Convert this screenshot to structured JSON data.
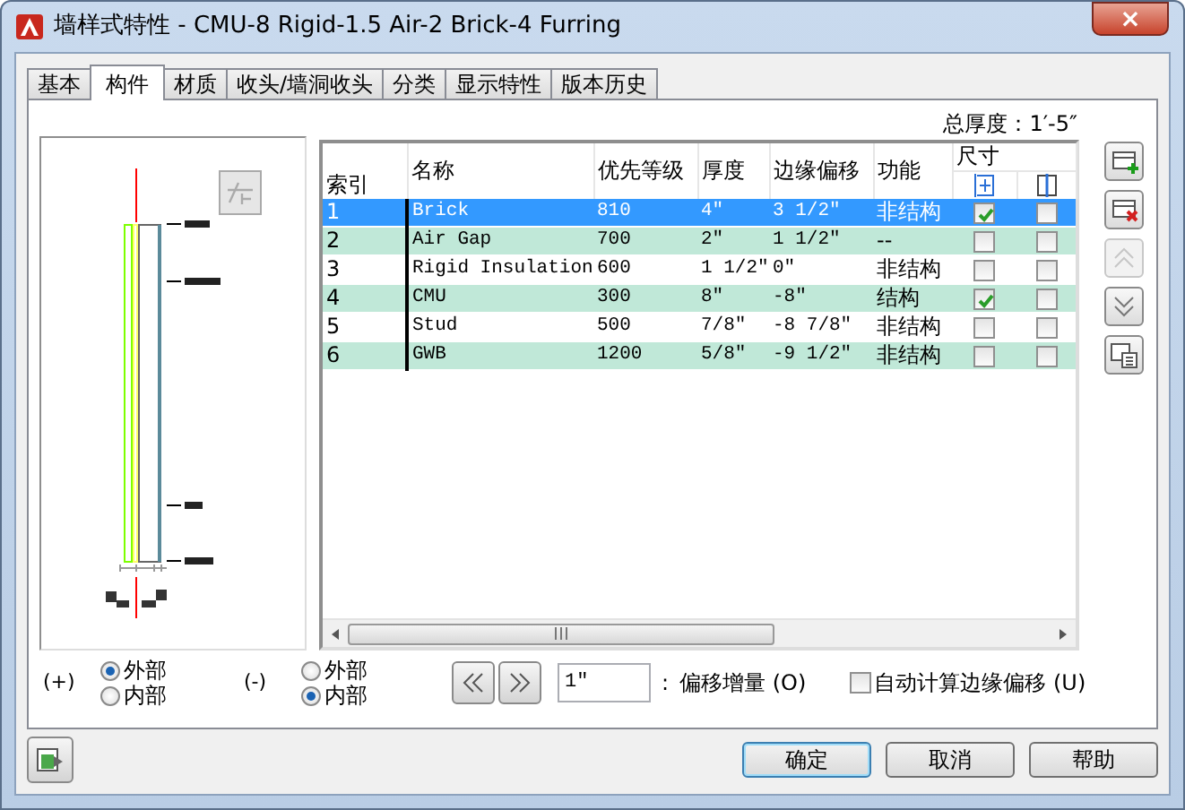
{
  "window": {
    "title": "墙样式特性 - CMU-8 Rigid-1.5 Air-2 Brick-4 Furring",
    "close": "×"
  },
  "tabs": [
    {
      "label": "基本",
      "selected": false
    },
    {
      "label": "构件",
      "selected": true
    },
    {
      "label": "材质",
      "selected": false
    },
    {
      "label": "收头/墙洞收头",
      "selected": false
    },
    {
      "label": "分类",
      "selected": false
    },
    {
      "label": "显示特性",
      "selected": false
    },
    {
      "label": "版本历史",
      "selected": false
    }
  ],
  "total_thickness": "总厚度：1′-5″",
  "table": {
    "columns": [
      "索引",
      "名称",
      "优先等级",
      "厚度",
      "边缘偏移",
      "功能"
    ],
    "dimension_group": "尺寸",
    "rows": [
      {
        "index": "1",
        "name": "Brick",
        "priority": "810",
        "thickness": "4″",
        "offset": "3 1/2″",
        "function": "非结构",
        "dim_a": true,
        "dim_b": false,
        "selected": true
      },
      {
        "index": "2",
        "name": "Air Gap",
        "priority": "700",
        "thickness": "2″",
        "offset": "1 1/2″",
        "function": "--",
        "dim_a": false,
        "dim_b": false,
        "selected": false
      },
      {
        "index": "3",
        "name": "Rigid Insulation",
        "priority": "600",
        "thickness": "1 1/2″",
        "offset": "0″",
        "function": "非结构",
        "dim_a": false,
        "dim_b": false,
        "selected": false
      },
      {
        "index": "4",
        "name": "CMU",
        "priority": "300",
        "thickness": "8″",
        "offset": "-8″",
        "function": "结构",
        "dim_a": true,
        "dim_b": false,
        "selected": false
      },
      {
        "index": "5",
        "name": "Stud",
        "priority": "500",
        "thickness": "7/8″",
        "offset": "-8 7/8″",
        "function": "非结构",
        "dim_a": false,
        "dim_b": false,
        "selected": false
      },
      {
        "index": "6",
        "name": "GWB",
        "priority": "1200",
        "thickness": "5/8″",
        "offset": "-9 1/2″",
        "function": "非结构",
        "dim_a": false,
        "dim_b": false,
        "selected": false
      }
    ]
  },
  "toolbar": [
    {
      "kind": "add",
      "disabled": false
    },
    {
      "kind": "remove",
      "disabled": false
    },
    {
      "kind": "up",
      "disabled": true
    },
    {
      "kind": "down",
      "disabled": false
    },
    {
      "kind": "details",
      "disabled": false
    }
  ],
  "positive_side": {
    "label": "(+)",
    "options": [
      {
        "label": "外部",
        "selected": true
      },
      {
        "label": "内部",
        "selected": false
      }
    ]
  },
  "negative_side": {
    "label": "(-)",
    "options": [
      {
        "label": "外部",
        "selected": false
      },
      {
        "label": "内部",
        "selected": true
      }
    ]
  },
  "offset_increment": {
    "value": "1″",
    "separator": ":",
    "label": "偏移增量 (O)"
  },
  "auto_offset": {
    "label": "自动计算边缘偏移 (U)",
    "checked": false
  },
  "buttons": [
    {
      "label": "确定",
      "default": true
    },
    {
      "label": "取消",
      "default": false
    },
    {
      "label": "帮助",
      "default": false
    }
  ]
}
